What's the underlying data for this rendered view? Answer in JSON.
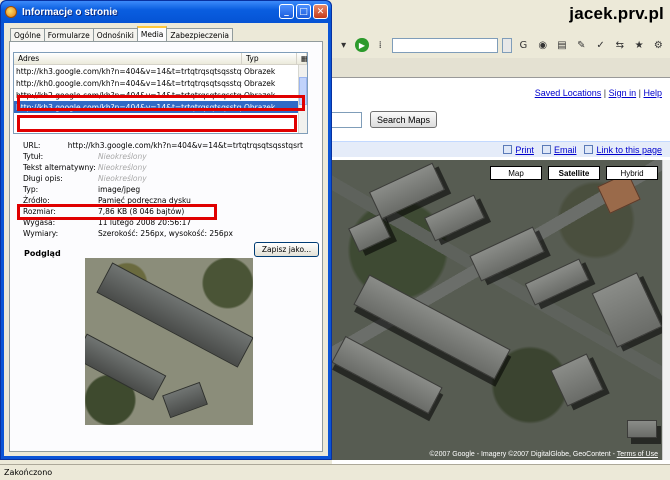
{
  "watermark": "jacek.prv.pl",
  "browser": {
    "top_links": [
      "Saved Locations",
      "Sign in",
      "Help"
    ],
    "search_button": "Search Maps",
    "link_bar": [
      "Print",
      "Email",
      "Link to this page"
    ],
    "map_types": [
      "Map",
      "Satellite",
      "Hybrid"
    ],
    "copyright": "©2007 Google - Imagery ©2007 DigitalGlobe, GeoContent - ",
    "terms": "Terms of Use",
    "status": "Zakończono"
  },
  "dialog": {
    "title": "Informacje o stronie",
    "tabs": [
      "Ogólne",
      "Formularze",
      "Odnośniki",
      "Media",
      "Zabezpieczenia"
    ],
    "active_tab": "Media",
    "list": {
      "col_address": "Adres",
      "col_type": "Typ",
      "rows": [
        {
          "url": "http://kh3.google.com/kh?n=404&v=14&t=trtqtrqsqtsqsstqstr",
          "type": "Obrazek"
        },
        {
          "url": "http://kh0.google.com/kh?n=404&v=14&t=trtqtrqsqtsqsstqsts",
          "type": "Obrazek"
        },
        {
          "url": "http://kh2.google.com/kh?n=404&v=14&t=trtqtrqsqtsqsstqsrq",
          "type": "Obrazek"
        },
        {
          "url": "http://kh3.google.com/kh?n=404&v=14&t=trtqtrqsqtsqsstqsrt",
          "type": "Obrazek"
        }
      ]
    },
    "properties": {
      "url_label": "URL:",
      "url_value": "http://kh3.google.com/kh?n=404&v=14&t=trtqtrqsqtsqsstqsrt",
      "alt_text_label": "Tytuł:",
      "alt_text_value": "Nieokreślony",
      "alt_label": "Tekst alternatywny:",
      "alt_value": "Nieokreślony",
      "desc_label": "Długi opis:",
      "desc_value": "Nieokreślony",
      "type_label": "Typ:",
      "type_value": "image/jpeg",
      "source_label": "Źródło:",
      "source_value": "Pamięć podręczna dysku",
      "size_label": "Rozmiar:",
      "size_value": "7,86 KB (8 046 bajtów)",
      "expires_label": "Wygasa:",
      "expires_value": "11 lutego 2008 20:56:17",
      "dims_label": "Wymiary:",
      "dims_value": "Szerokość: 256px, wysokość: 256px"
    },
    "save_button": "Zapisz jako...",
    "preview_label": "Podgląd"
  },
  "colors": {
    "highlight": "#e00000",
    "selection": "#316ac5",
    "link": "#0000cc",
    "titlebar": "#0a5ee0"
  }
}
